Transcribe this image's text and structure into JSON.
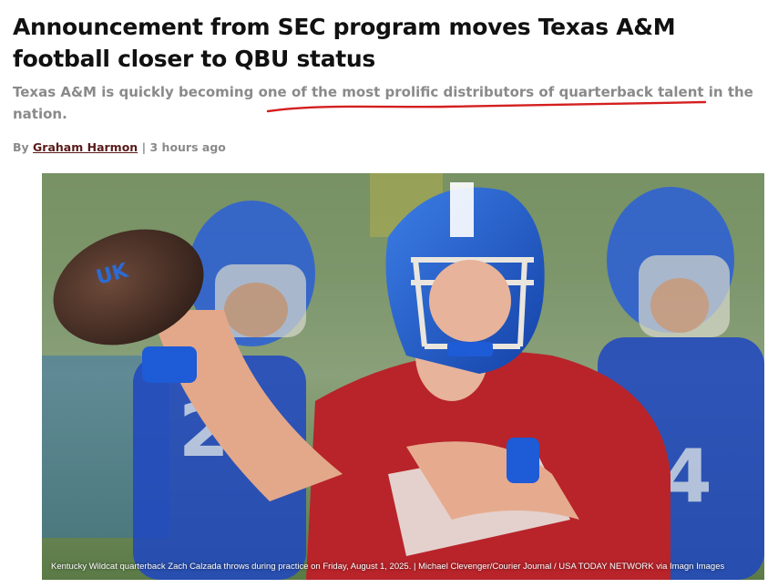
{
  "article": {
    "headline": "Announcement from SEC program moves Texas A&M football closer to QBU status",
    "subheadline": "Texas A&M is quickly becoming one of the most prolific distributors of quarterback talent in the nation.",
    "byline": {
      "prefix": "By",
      "author": "Graham Harmon",
      "separator": "|",
      "timestamp": "3 hours ago"
    },
    "image": {
      "caption": "Kentucky Wildcat quarterback Zach Calzada throws during practice on Friday, August 1, 2025. | Michael Clevenger/Courier Journal / USA TODAY NETWORK via Imagn Images",
      "helmet_logo": "UK",
      "jersey_numbers": [
        "22",
        "4"
      ]
    },
    "colors": {
      "headline": "#111111",
      "subhead": "#8a8a8a",
      "author_link": "#5a1a1a",
      "annotation_underline": "#d41f1f"
    }
  }
}
